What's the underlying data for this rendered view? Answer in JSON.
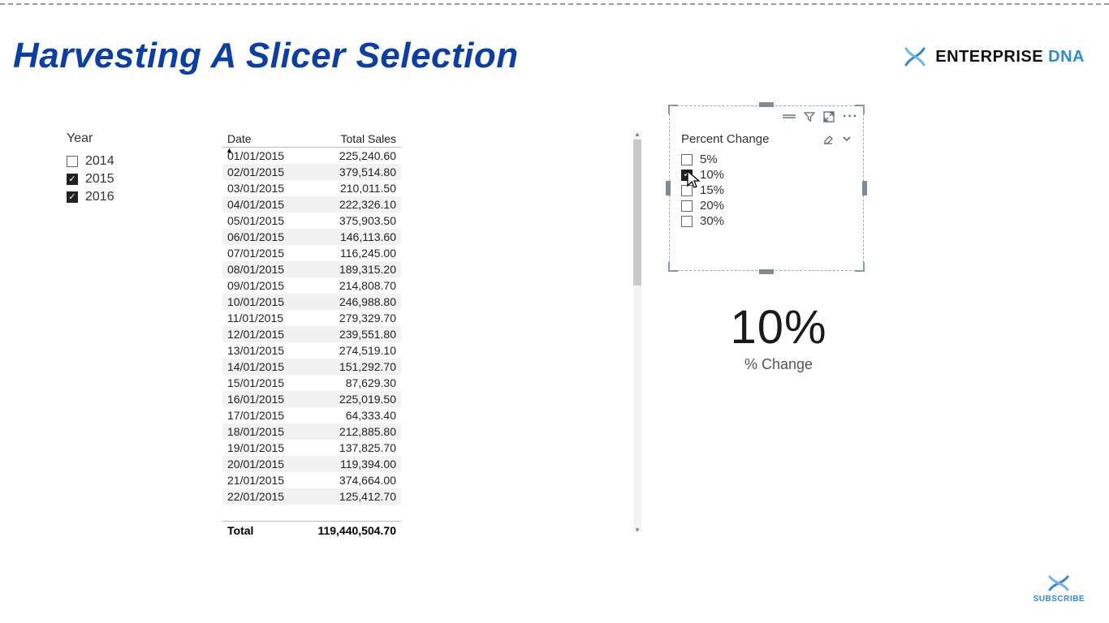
{
  "title": "Harvesting A Slicer Selection",
  "brand": {
    "text1": "ENTERPRISE",
    "text2": "DNA",
    "subscribe": "SUBSCRIBE"
  },
  "year_slicer": {
    "title": "Year",
    "items": [
      {
        "label": "2014",
        "checked": false
      },
      {
        "label": "2015",
        "checked": true
      },
      {
        "label": "2016",
        "checked": true
      }
    ]
  },
  "table": {
    "columns": {
      "date": "Date",
      "total_sales": "Total Sales"
    },
    "rows": [
      {
        "date": "01/01/2015",
        "sales": "225,240.60"
      },
      {
        "date": "02/01/2015",
        "sales": "379,514.80"
      },
      {
        "date": "03/01/2015",
        "sales": "210,011.50"
      },
      {
        "date": "04/01/2015",
        "sales": "222,326.10"
      },
      {
        "date": "05/01/2015",
        "sales": "375,903.50"
      },
      {
        "date": "06/01/2015",
        "sales": "146,113.60"
      },
      {
        "date": "07/01/2015",
        "sales": "116,245.00"
      },
      {
        "date": "08/01/2015",
        "sales": "189,315.20"
      },
      {
        "date": "09/01/2015",
        "sales": "214,808.70"
      },
      {
        "date": "10/01/2015",
        "sales": "246,988.80"
      },
      {
        "date": "11/01/2015",
        "sales": "279,329.70"
      },
      {
        "date": "12/01/2015",
        "sales": "239,551.80"
      },
      {
        "date": "13/01/2015",
        "sales": "274,519.10"
      },
      {
        "date": "14/01/2015",
        "sales": "151,292.70"
      },
      {
        "date": "15/01/2015",
        "sales": "87,629.30"
      },
      {
        "date": "16/01/2015",
        "sales": "225,019.50"
      },
      {
        "date": "17/01/2015",
        "sales": "64,333.40"
      },
      {
        "date": "18/01/2015",
        "sales": "212,885.80"
      },
      {
        "date": "19/01/2015",
        "sales": "137,825.70"
      },
      {
        "date": "20/01/2015",
        "sales": "119,394.00"
      },
      {
        "date": "21/01/2015",
        "sales": "374,664.00"
      },
      {
        "date": "22/01/2015",
        "sales": "125,412.70"
      }
    ],
    "total_label": "Total",
    "total_value": "119,440,504.70"
  },
  "pct_slicer": {
    "title": "Percent Change",
    "items": [
      {
        "label": "5%",
        "checked": false
      },
      {
        "label": "10%",
        "checked": true
      },
      {
        "label": "15%",
        "checked": false
      },
      {
        "label": "20%",
        "checked": false
      },
      {
        "label": "30%",
        "checked": false
      }
    ]
  },
  "card": {
    "value": "10%",
    "label": "% Change"
  }
}
